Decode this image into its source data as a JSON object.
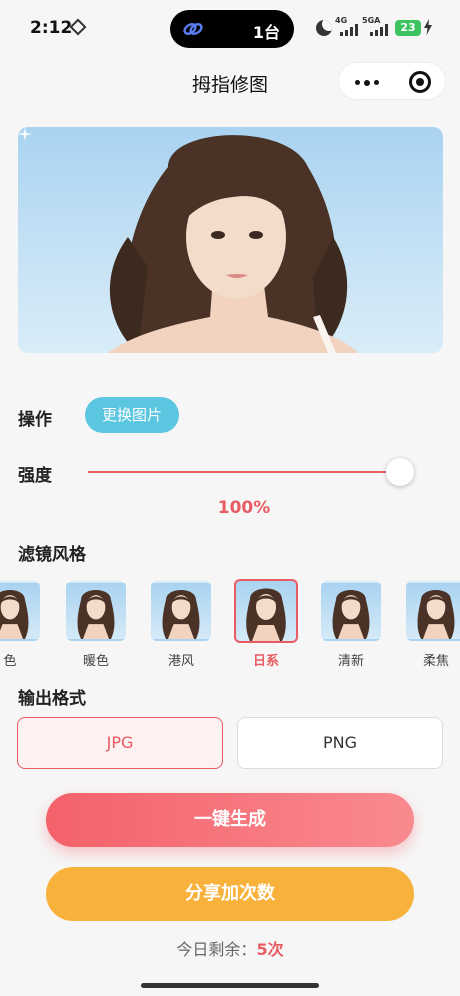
{
  "status_bar": {
    "time": "2:12",
    "island_count": "1台",
    "network_1": "4G",
    "network_2": "5GA",
    "battery": "23"
  },
  "nav": {
    "title": "拇指修图"
  },
  "controls": {
    "operation_label": "操作",
    "change_image_label": "更换图片",
    "strength_label": "强度",
    "strength_value": "100%",
    "strength_fraction": 1.0
  },
  "filters": {
    "title": "滤镜风格",
    "items": [
      {
        "label": "色"
      },
      {
        "label": "暖色"
      },
      {
        "label": "港风"
      },
      {
        "label": "日系",
        "active": true
      },
      {
        "label": "清新"
      },
      {
        "label": "柔焦"
      }
    ]
  },
  "format": {
    "title": "输出格式",
    "options": [
      "JPG",
      "PNG"
    ],
    "selected": "JPG"
  },
  "actions": {
    "generate_label": "一键生成",
    "share_label": "分享加次数",
    "remaining_prefix": "今日剩余：",
    "remaining_value": "5次"
  },
  "colors": {
    "accent_red": "#e85b63",
    "button_blue": "#5ac6e0",
    "button_orange": "#f8b23c"
  }
}
